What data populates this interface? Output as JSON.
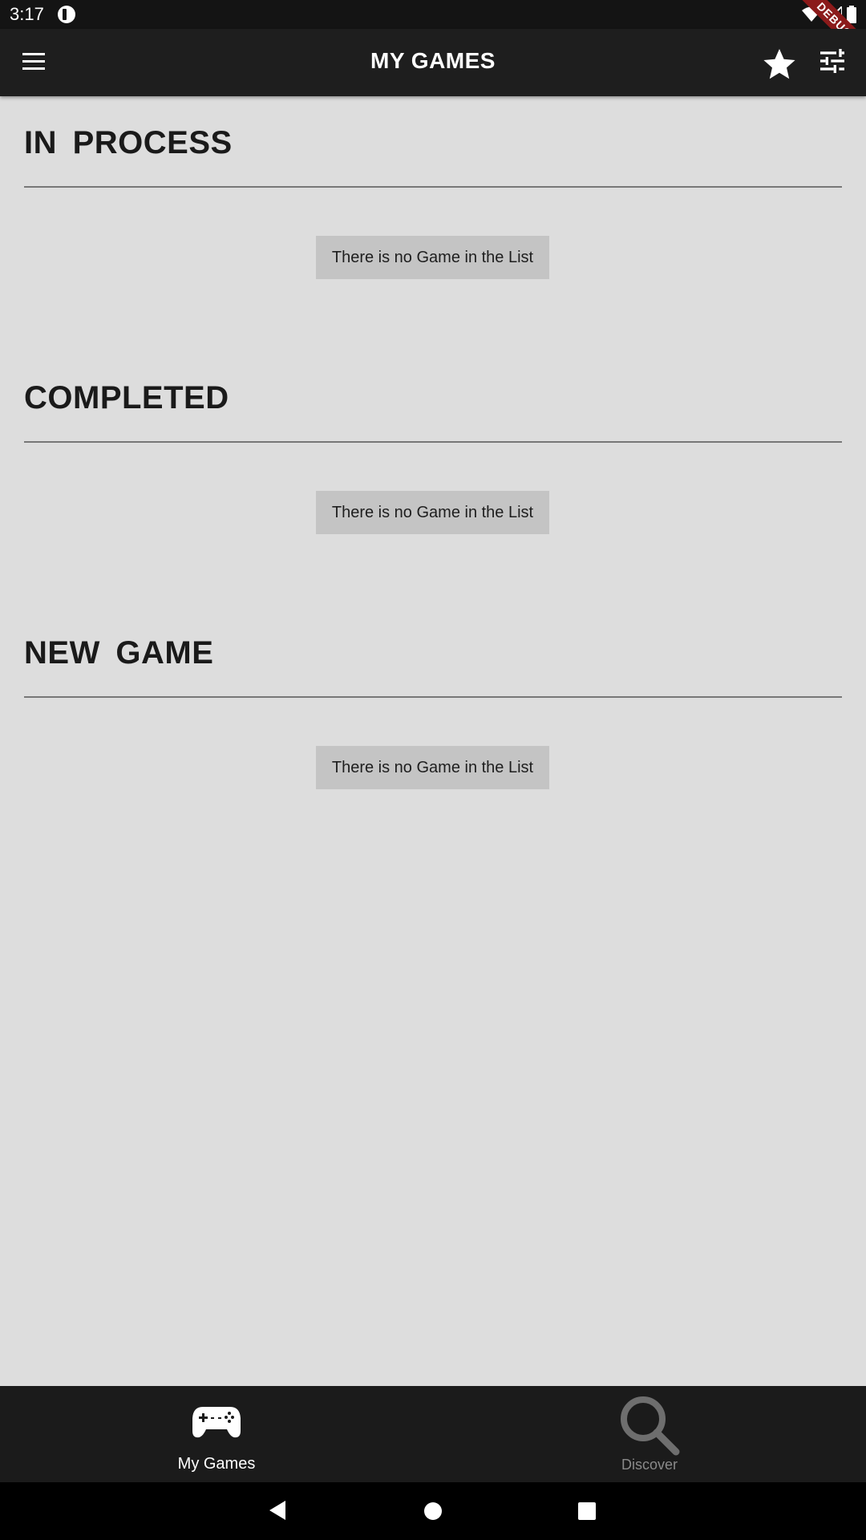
{
  "status_bar": {
    "time": "3:17",
    "debug_label": "DEBUG"
  },
  "app_bar": {
    "title": "MY GAMES",
    "icons": [
      "menu-icon",
      "star-icon",
      "tune-icon"
    ]
  },
  "sections": [
    {
      "title": "IN  PROCESS",
      "empty_text": "There is no Game in the List"
    },
    {
      "title": "COMPLETED",
      "empty_text": "There is no Game in the List"
    },
    {
      "title": "NEW  GAME",
      "empty_text": "There is no Game in the List"
    }
  ],
  "bottom_nav": {
    "items": [
      {
        "label": "My Games",
        "icon": "gamepad-icon",
        "active": true
      },
      {
        "label": "Discover",
        "icon": "search-icon",
        "active": false
      }
    ]
  },
  "colors": {
    "background": "#dddddd",
    "app_bar": "#1e1e1e",
    "chip": "#c4c4c4",
    "nav_active": "#ffffff",
    "nav_inactive": "#8a8a8a"
  }
}
